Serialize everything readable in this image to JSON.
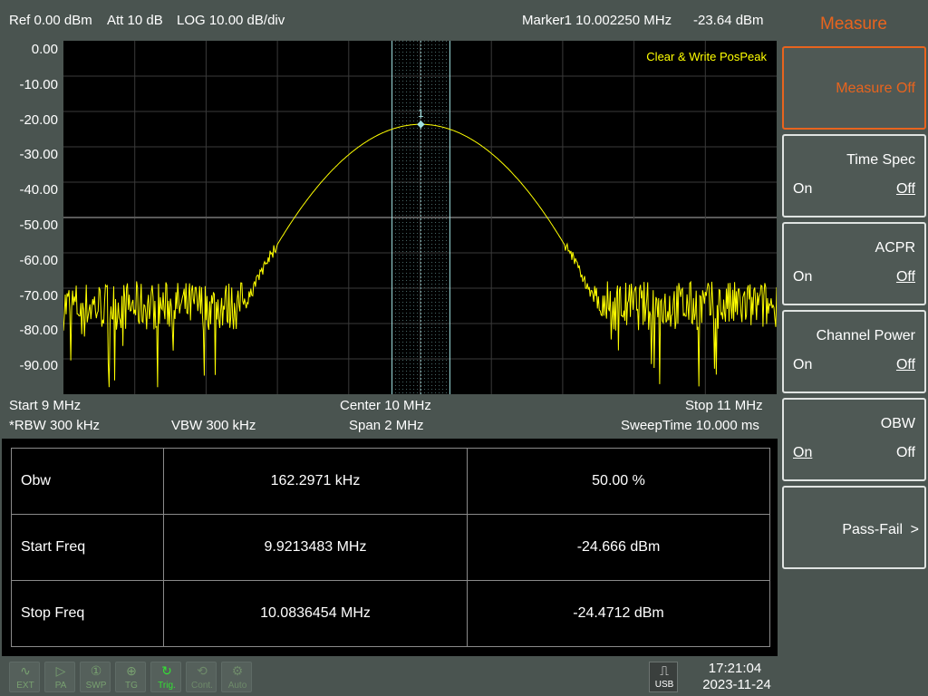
{
  "header": {
    "ref": "Ref 0.00 dBm",
    "att": "Att 10 dB",
    "scale": "LOG 10.00 dB/div",
    "marker": "Marker1 10.002250 MHz",
    "marker_level": "-23.64 dBm"
  },
  "plot": {
    "trace_mode": "Clear & Write PosPeak",
    "marker_label": "1",
    "trace_color": "#ffff00",
    "y_labels": [
      "0.00",
      "-10.00",
      "-20.00",
      "-30.00",
      "-40.00",
      "-50.00",
      "-60.00",
      "-70.00",
      "-80.00",
      "-90.00"
    ],
    "chart_data": {
      "type": "line",
      "title": "",
      "x_start_mhz": 9,
      "x_stop_mhz": 11,
      "ylim": [
        -100,
        0
      ],
      "peak": {
        "x_mhz": 10.00225,
        "y_dbm": -23.64
      },
      "noise_floor_dbm": -75,
      "obw_band_mhz": [
        9.9213483,
        10.0836454
      ]
    }
  },
  "freq": {
    "start": "Start 9 MHz",
    "center": "Center 10 MHz",
    "stop": "Stop 11 MHz",
    "rbw": "*RBW 300 kHz",
    "vbw": "VBW 300 kHz",
    "span": "Span 2 MHz",
    "sweep": "SweepTime 10.000 ms"
  },
  "table": {
    "rows": [
      {
        "name": "Obw",
        "value": "162.2971 kHz",
        "extra": "50.00 %"
      },
      {
        "name": "Start Freq",
        "value": "9.9213483 MHz",
        "extra": "-24.666 dBm"
      },
      {
        "name": "Stop Freq",
        "value": "10.0836454 MHz",
        "extra": "-24.4712 dBm"
      }
    ]
  },
  "menu": {
    "title": "Measure",
    "keys": [
      {
        "label": "Measure Off"
      },
      {
        "label": "Time Spec",
        "on": "On",
        "off": "Off"
      },
      {
        "label": "ACPR",
        "on": "On",
        "off": "Off"
      },
      {
        "label": "Channel Power",
        "on": "On",
        "off": "Off"
      },
      {
        "label": "OBW",
        "on": "On",
        "off": "Off"
      },
      {
        "label": "Pass-Fail",
        "arrow": ">"
      }
    ]
  },
  "statusbar": {
    "icons": [
      {
        "label": "EXT",
        "icon": "sine-wave-icon"
      },
      {
        "label": "PA",
        "icon": "amplifier-icon"
      },
      {
        "label": "SWP",
        "icon": "sweep-count-icon"
      },
      {
        "label": "TG",
        "icon": "tracking-generator-icon"
      },
      {
        "label": "Trig.",
        "icon": "trigger-icon"
      },
      {
        "label": "Cont.",
        "icon": "continuous-sweep-icon"
      },
      {
        "label": "Auto",
        "icon": "auto-gear-icon"
      }
    ],
    "usb": "USB",
    "time": "17:21:04",
    "date": "2023-11-24"
  }
}
